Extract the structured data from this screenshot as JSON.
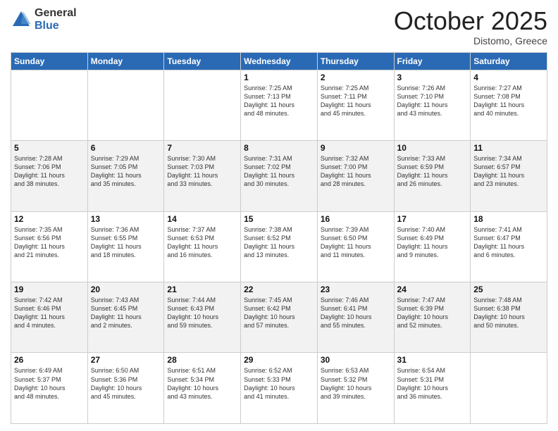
{
  "header": {
    "logo_general": "General",
    "logo_blue": "Blue",
    "month_title": "October 2025",
    "location": "Distomo, Greece"
  },
  "days_of_week": [
    "Sunday",
    "Monday",
    "Tuesday",
    "Wednesday",
    "Thursday",
    "Friday",
    "Saturday"
  ],
  "weeks": [
    [
      {
        "day": "",
        "info": ""
      },
      {
        "day": "",
        "info": ""
      },
      {
        "day": "",
        "info": ""
      },
      {
        "day": "1",
        "info": "Sunrise: 7:25 AM\nSunset: 7:13 PM\nDaylight: 11 hours\nand 48 minutes."
      },
      {
        "day": "2",
        "info": "Sunrise: 7:25 AM\nSunset: 7:11 PM\nDaylight: 11 hours\nand 45 minutes."
      },
      {
        "day": "3",
        "info": "Sunrise: 7:26 AM\nSunset: 7:10 PM\nDaylight: 11 hours\nand 43 minutes."
      },
      {
        "day": "4",
        "info": "Sunrise: 7:27 AM\nSunset: 7:08 PM\nDaylight: 11 hours\nand 40 minutes."
      }
    ],
    [
      {
        "day": "5",
        "info": "Sunrise: 7:28 AM\nSunset: 7:06 PM\nDaylight: 11 hours\nand 38 minutes."
      },
      {
        "day": "6",
        "info": "Sunrise: 7:29 AM\nSunset: 7:05 PM\nDaylight: 11 hours\nand 35 minutes."
      },
      {
        "day": "7",
        "info": "Sunrise: 7:30 AM\nSunset: 7:03 PM\nDaylight: 11 hours\nand 33 minutes."
      },
      {
        "day": "8",
        "info": "Sunrise: 7:31 AM\nSunset: 7:02 PM\nDaylight: 11 hours\nand 30 minutes."
      },
      {
        "day": "9",
        "info": "Sunrise: 7:32 AM\nSunset: 7:00 PM\nDaylight: 11 hours\nand 28 minutes."
      },
      {
        "day": "10",
        "info": "Sunrise: 7:33 AM\nSunset: 6:59 PM\nDaylight: 11 hours\nand 26 minutes."
      },
      {
        "day": "11",
        "info": "Sunrise: 7:34 AM\nSunset: 6:57 PM\nDaylight: 11 hours\nand 23 minutes."
      }
    ],
    [
      {
        "day": "12",
        "info": "Sunrise: 7:35 AM\nSunset: 6:56 PM\nDaylight: 11 hours\nand 21 minutes."
      },
      {
        "day": "13",
        "info": "Sunrise: 7:36 AM\nSunset: 6:55 PM\nDaylight: 11 hours\nand 18 minutes."
      },
      {
        "day": "14",
        "info": "Sunrise: 7:37 AM\nSunset: 6:53 PM\nDaylight: 11 hours\nand 16 minutes."
      },
      {
        "day": "15",
        "info": "Sunrise: 7:38 AM\nSunset: 6:52 PM\nDaylight: 11 hours\nand 13 minutes."
      },
      {
        "day": "16",
        "info": "Sunrise: 7:39 AM\nSunset: 6:50 PM\nDaylight: 11 hours\nand 11 minutes."
      },
      {
        "day": "17",
        "info": "Sunrise: 7:40 AM\nSunset: 6:49 PM\nDaylight: 11 hours\nand 9 minutes."
      },
      {
        "day": "18",
        "info": "Sunrise: 7:41 AM\nSunset: 6:47 PM\nDaylight: 11 hours\nand 6 minutes."
      }
    ],
    [
      {
        "day": "19",
        "info": "Sunrise: 7:42 AM\nSunset: 6:46 PM\nDaylight: 11 hours\nand 4 minutes."
      },
      {
        "day": "20",
        "info": "Sunrise: 7:43 AM\nSunset: 6:45 PM\nDaylight: 11 hours\nand 2 minutes."
      },
      {
        "day": "21",
        "info": "Sunrise: 7:44 AM\nSunset: 6:43 PM\nDaylight: 10 hours\nand 59 minutes."
      },
      {
        "day": "22",
        "info": "Sunrise: 7:45 AM\nSunset: 6:42 PM\nDaylight: 10 hours\nand 57 minutes."
      },
      {
        "day": "23",
        "info": "Sunrise: 7:46 AM\nSunset: 6:41 PM\nDaylight: 10 hours\nand 55 minutes."
      },
      {
        "day": "24",
        "info": "Sunrise: 7:47 AM\nSunset: 6:39 PM\nDaylight: 10 hours\nand 52 minutes."
      },
      {
        "day": "25",
        "info": "Sunrise: 7:48 AM\nSunset: 6:38 PM\nDaylight: 10 hours\nand 50 minutes."
      }
    ],
    [
      {
        "day": "26",
        "info": "Sunrise: 6:49 AM\nSunset: 5:37 PM\nDaylight: 10 hours\nand 48 minutes."
      },
      {
        "day": "27",
        "info": "Sunrise: 6:50 AM\nSunset: 5:36 PM\nDaylight: 10 hours\nand 45 minutes."
      },
      {
        "day": "28",
        "info": "Sunrise: 6:51 AM\nSunset: 5:34 PM\nDaylight: 10 hours\nand 43 minutes."
      },
      {
        "day": "29",
        "info": "Sunrise: 6:52 AM\nSunset: 5:33 PM\nDaylight: 10 hours\nand 41 minutes."
      },
      {
        "day": "30",
        "info": "Sunrise: 6:53 AM\nSunset: 5:32 PM\nDaylight: 10 hours\nand 39 minutes."
      },
      {
        "day": "31",
        "info": "Sunrise: 6:54 AM\nSunset: 5:31 PM\nDaylight: 10 hours\nand 36 minutes."
      },
      {
        "day": "",
        "info": ""
      }
    ]
  ]
}
